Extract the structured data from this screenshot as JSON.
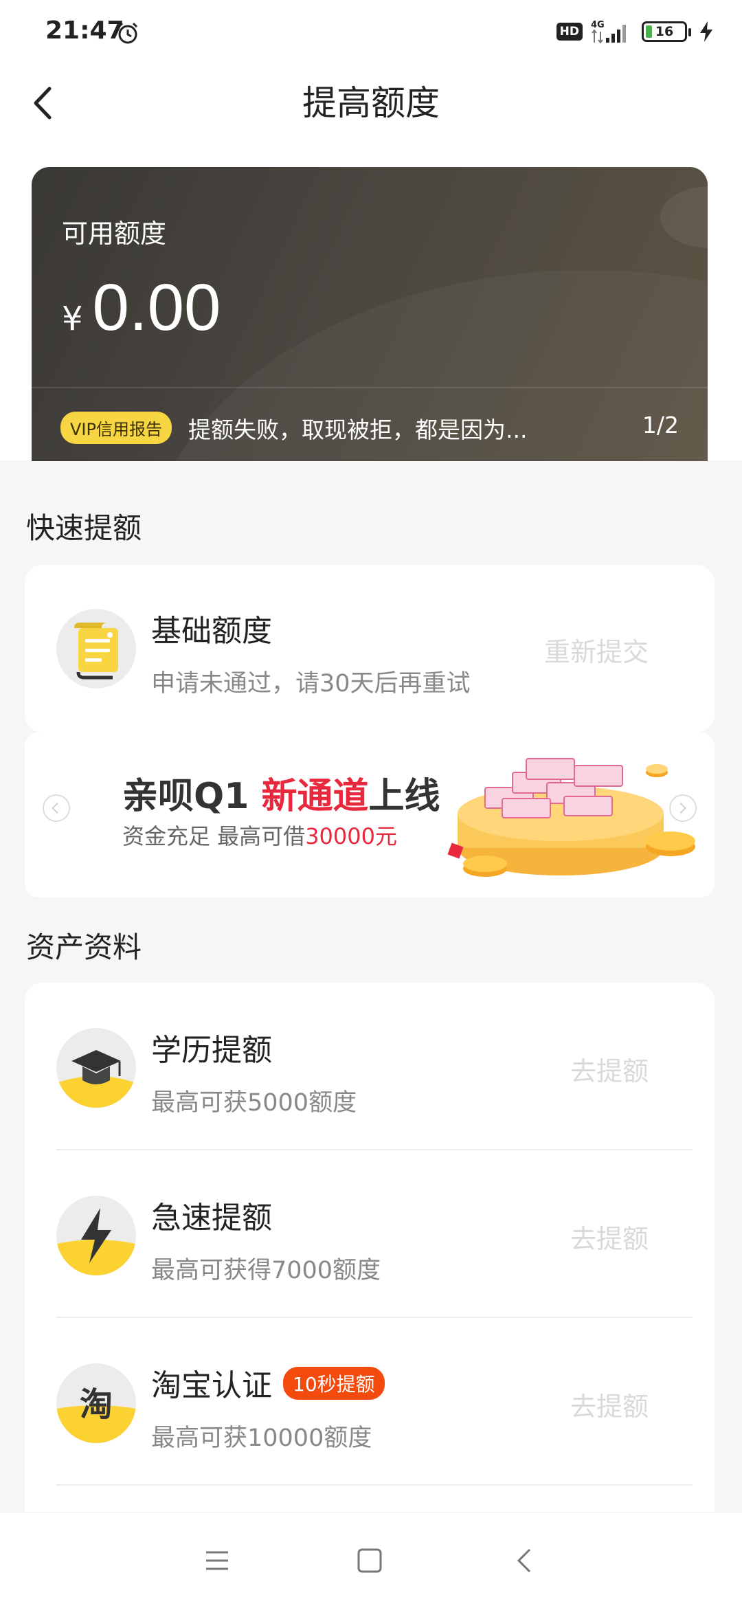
{
  "status_bar": {
    "time": "21:47",
    "network": "4G",
    "hd": "HD",
    "battery": "16",
    "battery_level": 0.16
  },
  "nav": {
    "title": "提高额度"
  },
  "card": {
    "label": "可用额度",
    "currency": "¥",
    "amount": "0.00",
    "badge": "VIP信用报告",
    "notice": "提额失败，取现被拒，都是因为...",
    "pager": "1/2"
  },
  "quick": {
    "title": "快速提额",
    "item": {
      "title": "基础额度",
      "subtitle": "申请未通过，请30天后再重试",
      "action": "重新提交"
    }
  },
  "banner": {
    "title_a": "亲呗Q1 ",
    "title_highlight": "新通道",
    "title_b": "上线",
    "sub_a": "资金充足  最高可借",
    "sub_highlight": "30000元"
  },
  "assets": {
    "title": "资产资料",
    "items": [
      {
        "title": "学历提额",
        "subtitle": "最高可获5000额度",
        "action": "去提额"
      },
      {
        "title": "急速提额",
        "subtitle": "最高可获得7000额度",
        "action": "去提额"
      },
      {
        "title": "淘宝认证",
        "tag": "10秒提额",
        "subtitle": "最高可获10000额度",
        "action": "去提额",
        "icon_text": "淘"
      }
    ]
  },
  "colors": {
    "accent_yellow": "#f8d542",
    "highlight_red": "#e8283c",
    "tag_orange": "#f34a0d"
  }
}
